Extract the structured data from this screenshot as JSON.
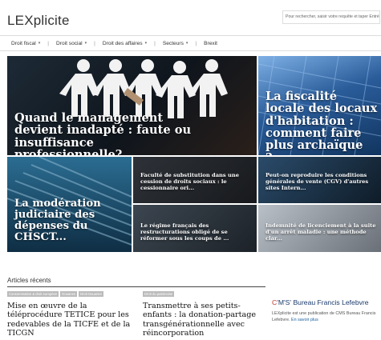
{
  "header": {
    "logo": "LEXplicite",
    "search_placeholder": "Pour rechercher, saisir votre requête et taper Entrée..."
  },
  "nav": {
    "items": [
      {
        "label": "Droit fiscal",
        "has_dropdown": true
      },
      {
        "label": "Droit social",
        "has_dropdown": true
      },
      {
        "label": "Droit des affaires",
        "has_dropdown": true
      },
      {
        "label": "Secteurs",
        "has_dropdown": true
      },
      {
        "label": "Brexit",
        "has_dropdown": false
      }
    ]
  },
  "featured": [
    {
      "title": "Quand le management devient inadapté : faute ou insuffisance professionnelle?..."
    },
    {
      "title": "La fiscalité locale des locaux d'habitation : comment faire plus archaïque ?..."
    },
    {
      "title": "La modération judiciaire des dépenses du CHSCT..."
    },
    {
      "title": "Faculté de substitution dans une cession de droits sociaux : le cessionnaire ori..."
    },
    {
      "title": "Peut-on reproduire les conditions générales de vente (CGV) d'autres sites Intern..."
    },
    {
      "title": "Le régime français des restructurations obligé de se réformer sous les coups de ..."
    },
    {
      "title": "Indemnité de licenciement à la suite d'un arrêt maladie : une méthode clar..."
    }
  ],
  "recent": {
    "heading": "Articles récents",
    "articles": [
      {
        "tags": [
          "Consommation & droit européen",
          "Douanes",
          "Droit Douanier"
        ],
        "title": "Mise en œuvre de la téléprocédure TETICE pour les redevables de la TICFE et de la TICGN"
      },
      {
        "tags": [
          "Droit du patrimoine"
        ],
        "title": "Transmettre à ses petits-enfants : la donation-partage transgénérationnelle avec réincorporation"
      }
    ]
  },
  "cms": {
    "logo_c": "C",
    "logo_rest": "'M'S'",
    "name": "Bureau Francis Lefebvre",
    "desc": "LEXplicite est une publication de CMS Bureau Francis Lefebvre.",
    "link": "En savoir plus"
  }
}
